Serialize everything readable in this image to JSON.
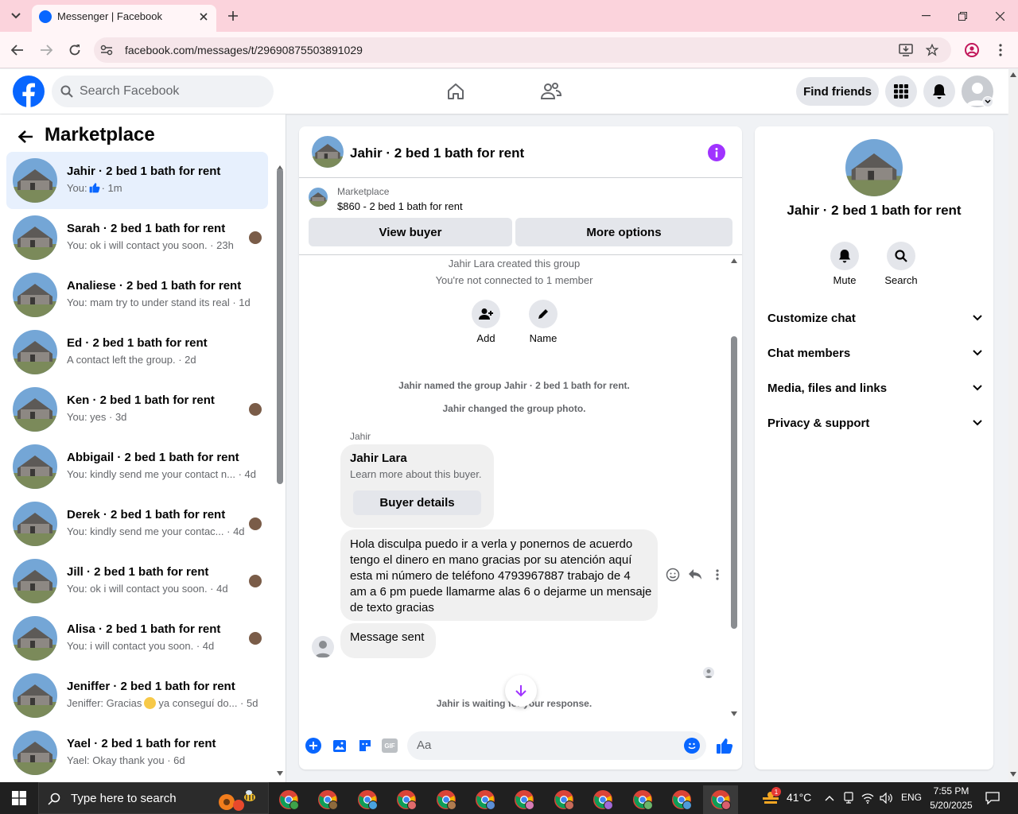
{
  "browser": {
    "tab_title": "Messenger | Facebook",
    "url": "facebook.com/messages/t/29690875503891029"
  },
  "header": {
    "search_placeholder": "Search Facebook",
    "find_friends": "Find friends"
  },
  "left": {
    "title": "Marketplace",
    "conversations": [
      {
        "name": "Jahir · 2 bed 1 bath for rent",
        "preview_prefix": "You:",
        "preview": "",
        "time": "· 1m",
        "selected": true
      },
      {
        "name": "Sarah · 2 bed 1 bath for rent",
        "preview": "You: ok i will contact you soon. · 23h"
      },
      {
        "name": "Analiese · 2 bed 1 bath for rent",
        "preview": "You: mam try to under stand its real · 1d"
      },
      {
        "name": "Ed · 2 bed 1 bath for rent",
        "preview": "A contact left the group. · 2d"
      },
      {
        "name": "Ken · 2 bed 1 bath for rent",
        "preview": "You: yes · 3d"
      },
      {
        "name": "Abbigail · 2 bed 1 bath for rent",
        "preview": "You: kindly send me your contact n... · 4d"
      },
      {
        "name": "Derek · 2 bed 1 bath for rent",
        "preview": "You: kindly send me your contac... · 4d"
      },
      {
        "name": "Jill · 2 bed 1 bath for rent",
        "preview": "You: ok i will contact you soon. · 4d"
      },
      {
        "name": "Alisa · 2 bed 1 bath for rent",
        "preview": "You: i will contact you soon. · 4d"
      },
      {
        "name": "Jeniffer · 2 bed 1 bath for rent",
        "preview_prefix": "Jeniffer: Gracias",
        "preview": "ya conseguí do... · 5d"
      },
      {
        "name": "Yael · 2 bed 1 bath for rent",
        "preview": "Yael: Okay thank you · 6d"
      }
    ]
  },
  "chat": {
    "title": "Jahir · 2 bed 1 bath for rent",
    "listing_source": "Marketplace",
    "listing_title": "$860 - 2 bed 1 bath for rent",
    "view_buyer": "View buyer",
    "more_options": "More options",
    "created": "Jahir Lara created this group",
    "not_connected": "You're not connected to 1 member",
    "add_label": "Add",
    "name_label": "Name",
    "named_group": "Jahir named the group Jahir · 2 bed 1 bath for rent.",
    "changed_photo": "Jahir changed the group photo.",
    "sender": "Jahir",
    "card_title": "Jahir Lara",
    "card_sub": "Learn more about this buyer.",
    "buyer_details": "Buyer details",
    "message_lines": [
      "Hola disculpa puedo ir a verla y ponernos de acuerdo",
      "tengo el dinero en mano gracias por su atención aquí",
      "esta mi número de teléfono 4793967887 trabajo de 4",
      "am a 6 pm puede llamarme alas 6 o dejarme un mensaje",
      "de texto gracias"
    ],
    "message_sent": "Message sent",
    "waiting": "Jahir is waiting for your response.",
    "input_placeholder": "Aa"
  },
  "right": {
    "title": "Jahir · 2 bed 1 bath for rent",
    "mute": "Mute",
    "search": "Search",
    "sections": [
      "Customize chat",
      "Chat members",
      "Media, files and links",
      "Privacy & support"
    ]
  },
  "taskbar": {
    "search_placeholder": "Type here to search",
    "temperature": "41°C",
    "language": "ENG",
    "time": "7:55 PM",
    "date": "5/20/2025",
    "weather_badge": "1"
  },
  "colors": {
    "fb_blue": "#0866ff",
    "info_purple": "#a033ff",
    "selected_bg": "#e7f0fd",
    "tab_bar_pink": "#fbd3dc"
  }
}
